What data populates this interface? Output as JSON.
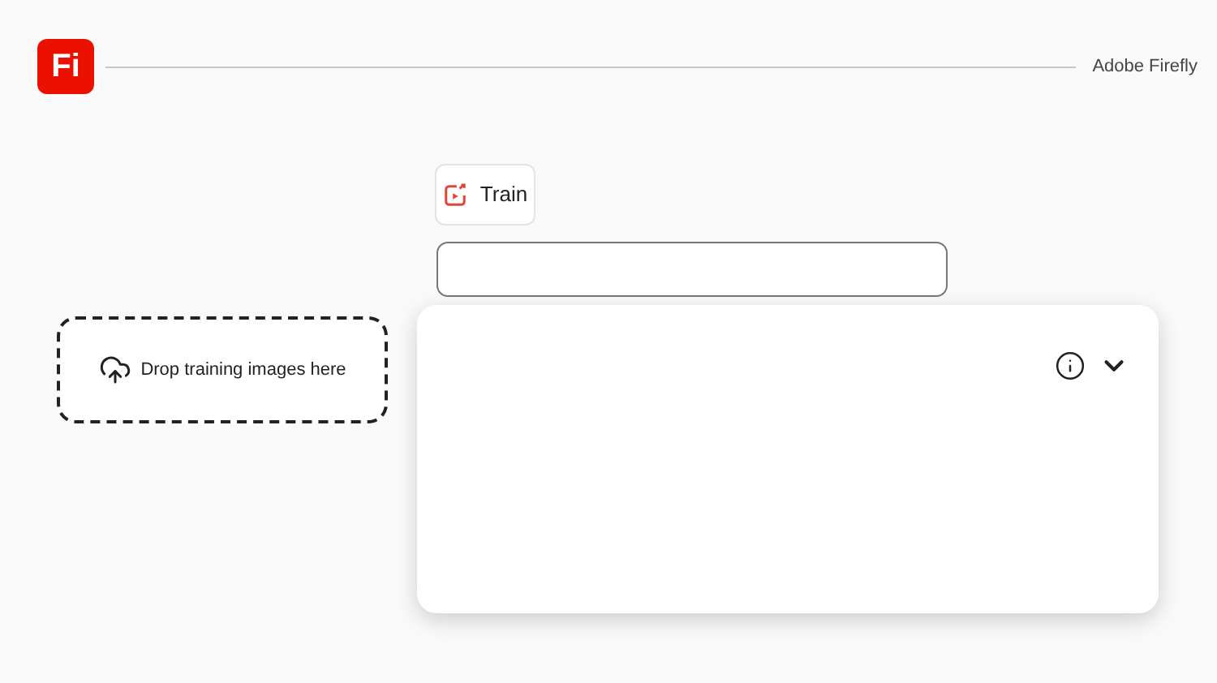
{
  "header": {
    "logo": "Fi",
    "brand": "Adobe Firefly"
  },
  "train_button": {
    "label": "Train"
  },
  "dropzone": {
    "label": "Drop training images here"
  }
}
